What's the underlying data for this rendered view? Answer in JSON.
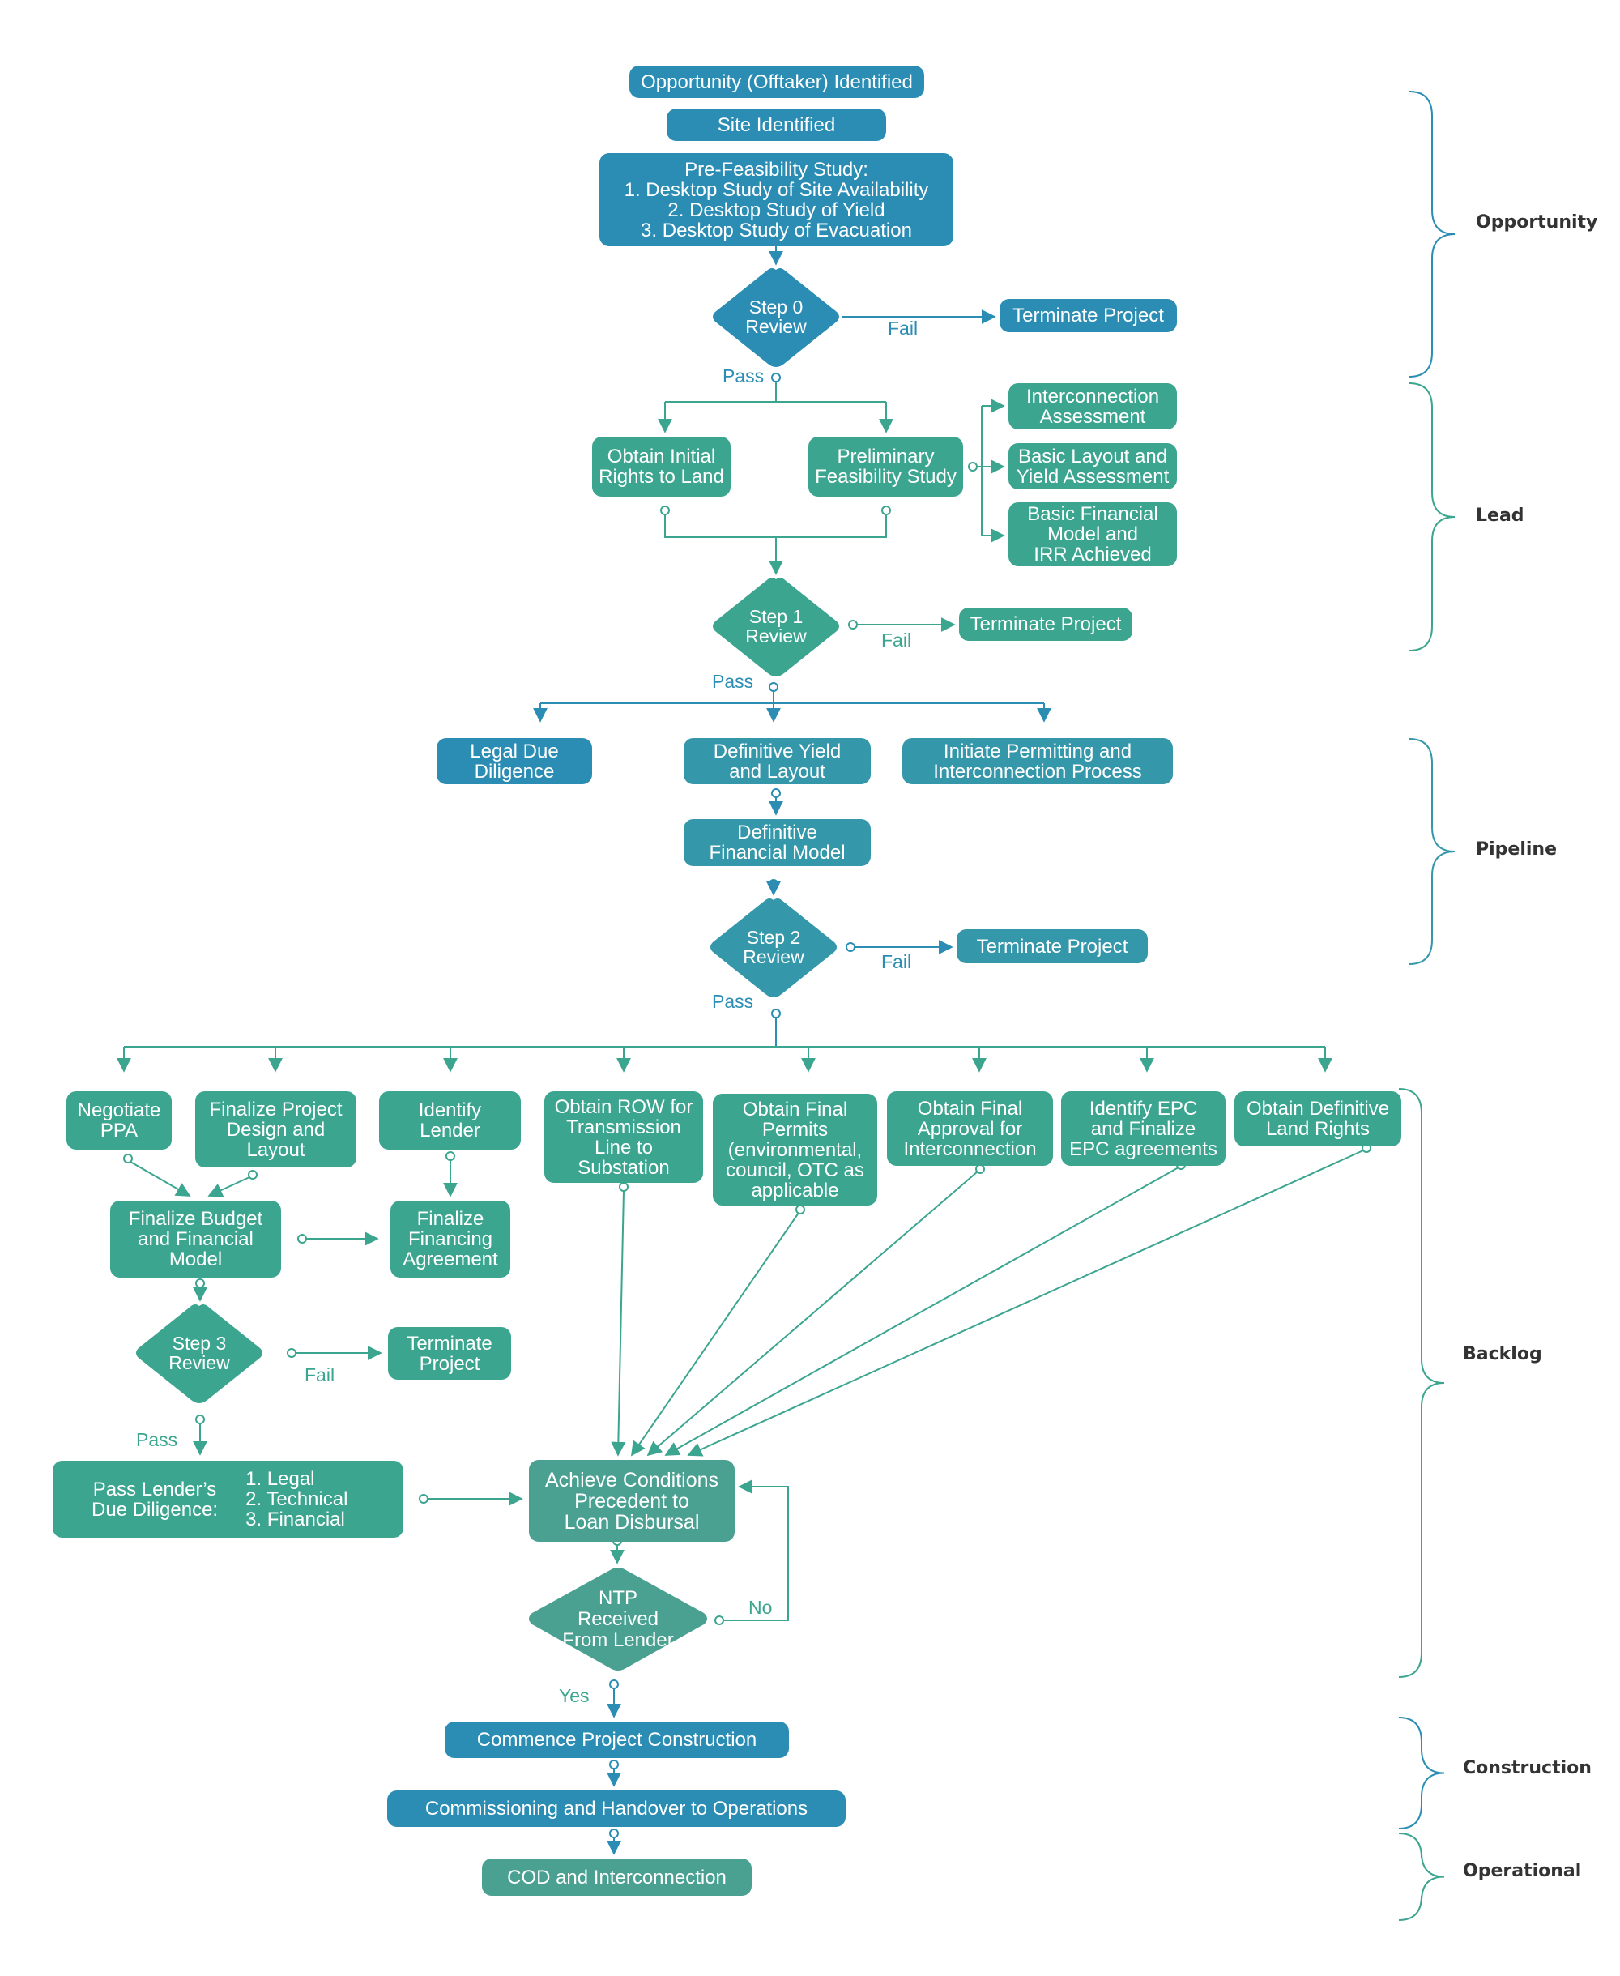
{
  "colors": {
    "blue": "#2b8db3",
    "teal": "#3ba58f",
    "pipeline": "#3597aa",
    "muted_teal": "#4aa192",
    "label_text": "#333333",
    "background": "#ffffff"
  },
  "opportunity": {
    "offtaker": "Opportunity (Offtaker) Identified",
    "site": "Site Identified",
    "prefeasibility": "Pre-Feasibility Study:\n1. Desktop Study of Site Availability\n2. Desktop Study of Yield\n3. Desktop Study of Evacuation",
    "step0": "Step 0\nReview",
    "terminate": "Terminate Project",
    "fail": "Fail",
    "pass": "Pass"
  },
  "lead": {
    "initial_rights": "Obtain Initial\nRights to Land",
    "preliminary": "Preliminary\nFeasibility Study",
    "interconnection": "Interconnection\nAssessment",
    "basic_layout": "Basic Layout and\nYield Assessment",
    "basic_financial": "Basic Financial\nModel and\nIRR Achieved",
    "step1": "Step 1\nReview",
    "terminate": "Terminate Project",
    "fail": "Fail",
    "pass": "Pass"
  },
  "pipeline": {
    "legal_dd": "Legal Due\nDiligence",
    "def_yield": "Definitive Yield\nand Layout",
    "permitting": "Initiate Permitting and\nInterconnection Process",
    "def_financial": "Definitive\nFinancial Model",
    "step2": "Step 2\nReview",
    "terminate": "Terminate Project",
    "fail": "Fail",
    "pass": "Pass"
  },
  "backlog": {
    "ppa": "Negotiate\nPPA",
    "design": "Finalize Project\nDesign and\nLayout",
    "lender": "Identify\nLender",
    "row": "Obtain ROW for\nTransmission\nLine to\nSubstation",
    "permits": "Obtain Final\nPermits\n(environmental,\ncouncil, OTC as\napplicable",
    "approval": "Obtain Final\nApproval for\nInterconnection",
    "epc": "Identify EPC\nand Finalize\nEPC agreements",
    "land": "Obtain Definitive\nLand Rights",
    "budget": "Finalize Budget\nand Financial\nModel",
    "financing": "Finalize\nFinancing\nAgreement",
    "step3": "Step 3\nReview",
    "terminate": "Terminate\nProject",
    "fail": "Fail",
    "pass": "Pass",
    "lender_dd_title": "Pass Lender’s\nDue Diligence:",
    "lender_dd_items": "1. Legal\n2. Technical\n3. Financial",
    "conditions": "Achieve Conditions\nPrecedent to\nLoan Disbursal",
    "ntp": "NTP\nReceived\nFrom Lender",
    "no": "No",
    "yes": "Yes"
  },
  "construction": {
    "commence": "Commence Project Construction",
    "commissioning": "Commissioning and Handover to Operations"
  },
  "operational": {
    "cod": "COD and Interconnection"
  },
  "phases": [
    "Opportunity",
    "Lead",
    "Pipeline",
    "Backlog",
    "Construction",
    "Operational"
  ]
}
